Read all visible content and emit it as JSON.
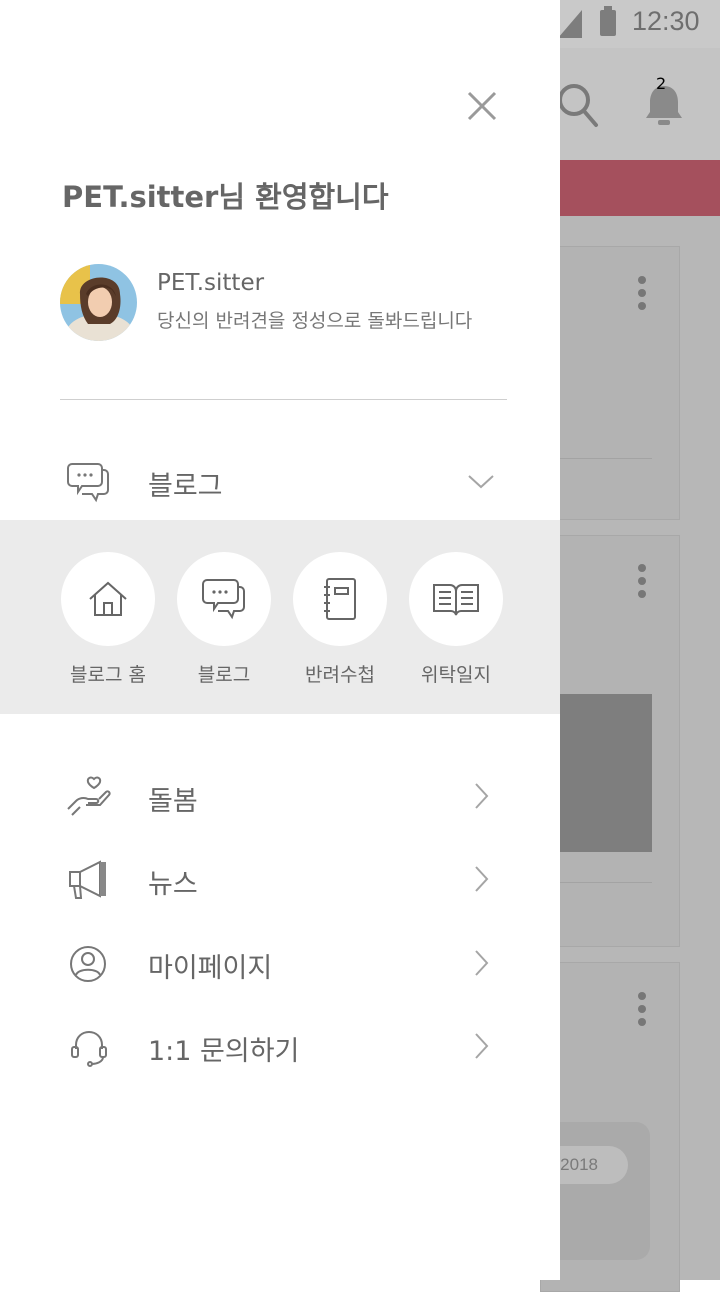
{
  "status_bar": {
    "time": "12:30"
  },
  "app_bar": {
    "notification_count": "2"
  },
  "background": {
    "date_pill": "2018"
  },
  "drawer": {
    "welcome_text": "PET.sitter님 환영합니다",
    "profile": {
      "name": "PET.sitter",
      "description": "당신의 반려견을 정성으로 돌봐드립니다"
    },
    "blog_menu": {
      "label": "블로그",
      "icon": "chat-bubbles-icon",
      "sub_items": [
        {
          "label": "블로그 홈",
          "icon": "home-icon"
        },
        {
          "label": "블로그",
          "icon": "chat-bubbles-icon"
        },
        {
          "label": "반려수첩",
          "icon": "notebook-icon"
        },
        {
          "label": "위탁일지",
          "icon": "open-book-icon"
        }
      ]
    },
    "menu_items": [
      {
        "label": "돌봄",
        "icon": "care-hand-heart-icon"
      },
      {
        "label": "뉴스",
        "icon": "megaphone-icon"
      },
      {
        "label": "마이페이지",
        "icon": "user-circle-icon"
      },
      {
        "label": "1:1 문의하기",
        "icon": "headset-icon"
      }
    ]
  },
  "colors": {
    "accent_red": "#a5505d",
    "badge_red": "#c9505e",
    "dim_overlay": "#b7b7b7",
    "submenu_bg": "#ebebeb",
    "text_gray": "#666666"
  }
}
